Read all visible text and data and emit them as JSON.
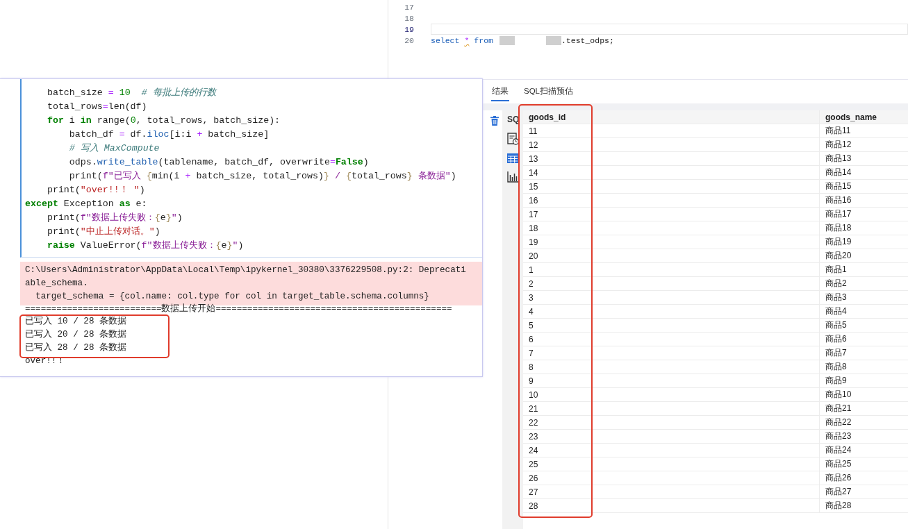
{
  "sql_editor": {
    "lines": [
      {
        "number": "17",
        "current": false
      },
      {
        "number": "18",
        "current": false
      },
      {
        "number": "19",
        "current": true
      },
      {
        "number": "20",
        "current": false,
        "tokens": [
          {
            "kind": "kw",
            "text": "select"
          },
          {
            "kind": "op",
            "text": "*",
            "warning": true
          },
          {
            "kind": "kw",
            "text": "from"
          },
          {
            "kind": "redacted"
          },
          {
            "kind": "redacted"
          },
          {
            "kind": "plain",
            "text": ".test_odps;"
          }
        ]
      }
    ]
  },
  "results": {
    "tabs": [
      {
        "label": "结果",
        "selected": true
      },
      {
        "label": "SQL扫描预估",
        "selected": false
      }
    ],
    "toolbar_label": "SQ",
    "table": {
      "columns": [
        "goods_id",
        "goods_name"
      ],
      "rows": [
        [
          "11",
          "商品11"
        ],
        [
          "12",
          "商品12"
        ],
        [
          "13",
          "商品13"
        ],
        [
          "14",
          "商品14"
        ],
        [
          "15",
          "商品15"
        ],
        [
          "16",
          "商品16"
        ],
        [
          "17",
          "商品17"
        ],
        [
          "18",
          "商品18"
        ],
        [
          "19",
          "商品19"
        ],
        [
          "20",
          "商品20"
        ],
        [
          "1",
          "商品1"
        ],
        [
          "2",
          "商品2"
        ],
        [
          "3",
          "商品3"
        ],
        [
          "4",
          "商品4"
        ],
        [
          "5",
          "商品5"
        ],
        [
          "6",
          "商品6"
        ],
        [
          "7",
          "商品7"
        ],
        [
          "8",
          "商品8"
        ],
        [
          "9",
          "商品9"
        ],
        [
          "10",
          "商品10"
        ],
        [
          "21",
          "商品21"
        ],
        [
          "22",
          "商品22"
        ],
        [
          "23",
          "商品23"
        ],
        [
          "24",
          "商品24"
        ],
        [
          "25",
          "商品25"
        ],
        [
          "26",
          "商品26"
        ],
        [
          "27",
          "商品27"
        ],
        [
          "28",
          "商品28"
        ]
      ]
    }
  },
  "notebook": {
    "code_lines": [
      [
        {
          "kind": "plain",
          "text": "    batch_size "
        },
        {
          "kind": "op",
          "text": "="
        },
        {
          "kind": "num",
          "text": " 10"
        },
        {
          "kind": "comment",
          "text": "  # 每批上传的行数"
        }
      ],
      [
        {
          "kind": "plain",
          "text": "    total_rows"
        },
        {
          "kind": "op",
          "text": "="
        },
        {
          "kind": "plain",
          "text": "len(df)"
        }
      ],
      [
        {
          "kind": "kw",
          "text": "    for"
        },
        {
          "kind": "plain",
          "text": " i "
        },
        {
          "kind": "kw",
          "text": "in"
        },
        {
          "kind": "plain",
          "text": " range("
        },
        {
          "kind": "num",
          "text": "0"
        },
        {
          "kind": "plain",
          "text": ", total_rows, batch_size):"
        }
      ],
      [
        {
          "kind": "plain",
          "text": "        batch_df "
        },
        {
          "kind": "op",
          "text": "="
        },
        {
          "kind": "plain",
          "text": " df."
        },
        {
          "kind": "attr",
          "text": "iloc"
        },
        {
          "kind": "plain",
          "text": "[i:i "
        },
        {
          "kind": "op",
          "text": "+"
        },
        {
          "kind": "plain",
          "text": " batch_size]"
        }
      ],
      [
        {
          "kind": "comment",
          "text": "        # 写入 MaxCompute"
        }
      ],
      [
        {
          "kind": "plain",
          "text": "        odps."
        },
        {
          "kind": "attr",
          "text": "write_table"
        },
        {
          "kind": "plain",
          "text": "(tablename, batch_df, overwrite"
        },
        {
          "kind": "op",
          "text": "="
        },
        {
          "kind": "kw",
          "text": "False"
        },
        {
          "kind": "plain",
          "text": ")"
        }
      ],
      [
        {
          "kind": "plain",
          "text": "        print("
        },
        {
          "kind": "fstr",
          "text": "f\"已写入 "
        },
        {
          "kind": "brace",
          "text": "{"
        },
        {
          "kind": "plain",
          "text": "min(i "
        },
        {
          "kind": "op",
          "text": "+"
        },
        {
          "kind": "plain",
          "text": " batch_size, total_rows)"
        },
        {
          "kind": "brace",
          "text": "}"
        },
        {
          "kind": "fstr",
          "text": " / "
        },
        {
          "kind": "brace",
          "text": "{"
        },
        {
          "kind": "plain",
          "text": "total_rows"
        },
        {
          "kind": "brace",
          "text": "}"
        },
        {
          "kind": "fstr",
          "text": " 条数据\""
        },
        {
          "kind": "plain",
          "text": ")"
        }
      ],
      [
        {
          "kind": "plain",
          "text": "    print("
        },
        {
          "kind": "str",
          "text": "\"over!!！ \""
        },
        {
          "kind": "plain",
          "text": ")"
        }
      ],
      [
        {
          "kind": "kw",
          "text": "except"
        },
        {
          "kind": "plain",
          "text": " Exception "
        },
        {
          "kind": "kw",
          "text": "as"
        },
        {
          "kind": "plain",
          "text": " e:"
        }
      ],
      [
        {
          "kind": "plain",
          "text": "    print("
        },
        {
          "kind": "fstr",
          "text": "f\"数据上传失败："
        },
        {
          "kind": "brace",
          "text": "{"
        },
        {
          "kind": "plain",
          "text": "e"
        },
        {
          "kind": "brace",
          "text": "}"
        },
        {
          "kind": "fstr",
          "text": "\""
        },
        {
          "kind": "plain",
          "text": ")"
        }
      ],
      [
        {
          "kind": "plain",
          "text": "    print("
        },
        {
          "kind": "str",
          "text": "\"中止上传对话。\""
        },
        {
          "kind": "plain",
          "text": ")"
        }
      ],
      [
        {
          "kind": "kw",
          "text": "    raise"
        },
        {
          "kind": "plain",
          "text": " ValueError("
        },
        {
          "kind": "fstr",
          "text": "f\"数据上传失败："
        },
        {
          "kind": "brace",
          "text": "{"
        },
        {
          "kind": "plain",
          "text": "e"
        },
        {
          "kind": "brace",
          "text": "}"
        },
        {
          "kind": "fstr",
          "text": "\""
        },
        {
          "kind": "plain",
          "text": ")"
        }
      ]
    ],
    "stderr": [
      "C:\\Users\\Administrator\\AppData\\Local\\Temp\\ipykernel_30380\\3376229508.py:2: Deprecati",
      "able_schema.",
      "  target_schema = {col.name: col.type for col in target_table.schema.columns}"
    ],
    "stdout": [
      "==========================数据上传开始=============================================",
      "已写入 10 / 28 条数据",
      "已写入 20 / 28 条数据",
      "已写入 28 / 28 条数据",
      "over!!！"
    ]
  }
}
